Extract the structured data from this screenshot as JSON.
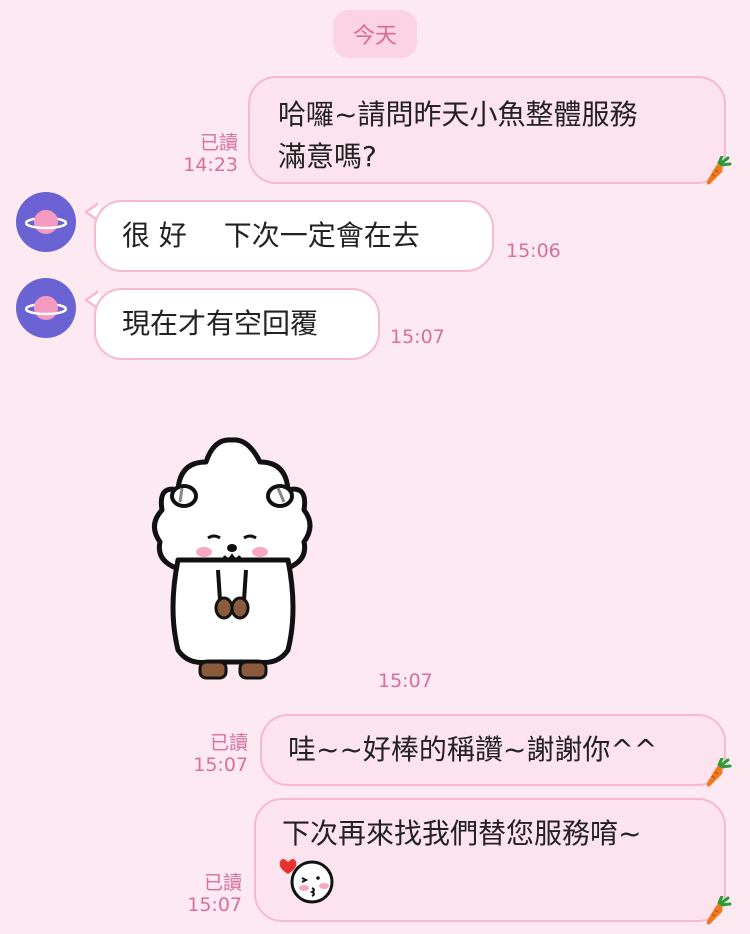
{
  "date_divider": "今天",
  "colors": {
    "background": "#fde9f2",
    "bubble_border": "#f6b9cf",
    "accent_text": "#d7709b",
    "avatar": "#6b63d4"
  },
  "messages": [
    {
      "side": "out",
      "text": "哈囉~請問昨天小魚整體服務\n滿意嗎?",
      "read_label": "已讀",
      "time": "14:23"
    },
    {
      "side": "in",
      "text": "很 好　 下次一定會在去",
      "time": "15:06"
    },
    {
      "side": "in",
      "text": "現在才有空回覆",
      "time": "15:07"
    },
    {
      "side": "in",
      "sticker": "white-sheep-bowing-sticker",
      "time": "15:07"
    },
    {
      "side": "out",
      "text": "哇~~好棒的稱讚~謝謝你^^",
      "read_label": "已讀",
      "time": "15:07"
    },
    {
      "side": "out",
      "text": "下次再來找我們替您服務唷~",
      "emoji": "kissing-face-heart-emoji",
      "read_label": "已讀",
      "time": "15:07"
    }
  ]
}
